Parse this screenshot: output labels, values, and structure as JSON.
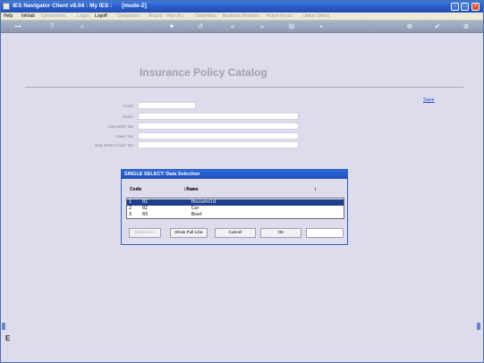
{
  "window": {
    "title": "IES Navigator Client v8.04 : My IES :      [mode-Z]"
  },
  "menu": [
    {
      "label": "Help",
      "enabled": true
    },
    {
      "label": "Infolab",
      "enabled": true
    },
    {
      "label": "Connections",
      "enabled": false
    },
    {
      "label": "Logon",
      "enabled": false
    },
    {
      "label": "Logoff",
      "enabled": true
    },
    {
      "label": "Companies",
      "enabled": false
    },
    {
      "label": "Wizard",
      "enabled": false
    },
    {
      "label": "How do I",
      "enabled": false
    },
    {
      "label": "DataFlows",
      "enabled": false
    },
    {
      "label": "Business Modules",
      "enabled": false
    },
    {
      "label": "Action Focus",
      "enabled": false
    },
    {
      "label": "Option Select",
      "enabled": false
    }
  ],
  "toolbar_icons": [
    "key-icon",
    "help-icon",
    "search-icon",
    "heart-icon",
    "undo-icon",
    "back-icon",
    "forward-icon",
    "grid-icon",
    "save-icon",
    "add-icon",
    "check-icon",
    "close-icon"
  ],
  "page": {
    "title": "Insurance Policy Catalog",
    "save_label": "Save",
    "fields": [
      {
        "label": "Code",
        "value": ""
      },
      {
        "label": "Name",
        "value": ""
      },
      {
        "label": "Claimable Tax",
        "value": ""
      },
      {
        "label": "Sales Tax",
        "value": ""
      },
      {
        "label": "Bad Debts Claim Tax",
        "value": ""
      }
    ]
  },
  "dialog": {
    "title": "SINGLE SELECT: Data Selection",
    "columns": [
      "Code",
      ":Name",
      ":"
    ],
    "rows": [
      {
        "index": "1",
        "code": "01",
        "name": "Household",
        "selected": true
      },
      {
        "index": "2",
        "code": "02",
        "name": "Car",
        "selected": false
      },
      {
        "index": "3",
        "code": "03",
        "name": "Boat",
        "selected": false
      }
    ],
    "buttons": {
      "select_all": "Select ALL",
      "show_full_line": "Show Full Line",
      "cancel": "Cancel",
      "ok": "OK"
    },
    "input_value": ""
  },
  "side": {
    "letter": "E"
  }
}
